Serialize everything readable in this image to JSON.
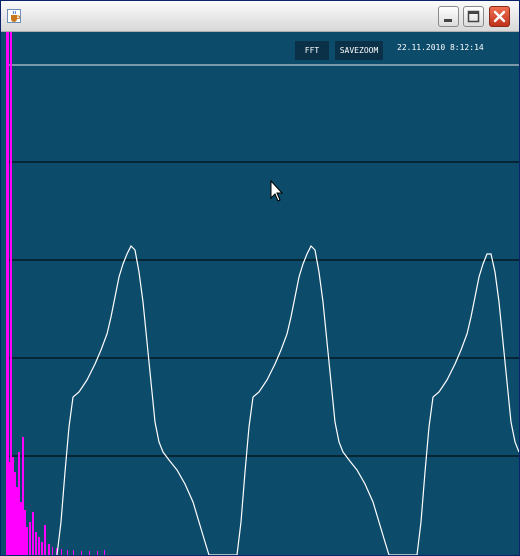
{
  "window": {
    "title": "",
    "controls": {
      "minimize": "minimize",
      "maximize": "maximize",
      "close": "close"
    }
  },
  "toolbar": {
    "fft_label": "FFT",
    "savezoom_label": "SAVEZOOM",
    "timestamp": "22.11.2010 8:12:14"
  },
  "colors": {
    "plot_background": "#0d4b6b",
    "waveform": "#ffffff",
    "spectrum": "#ff00ff",
    "grid": "#000000",
    "button_background": "#0a3148"
  },
  "icons": [
    "java-cup-icon",
    "minimize-icon",
    "maximize-icon",
    "close-icon",
    "mouse-pointer-icon"
  ],
  "chart_data": {
    "type": "line",
    "grid": true,
    "horizontal_gridlines": 4,
    "series": [
      {
        "values": []
      },
      {
        "values": []
      }
    ]
  }
}
